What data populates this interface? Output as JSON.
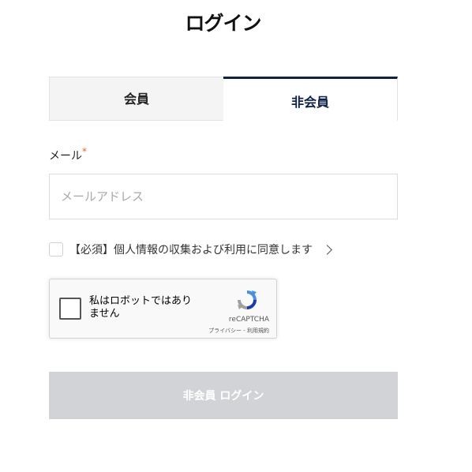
{
  "page": {
    "title": "ログイン"
  },
  "tabs": [
    {
      "label": "会員",
      "active": false
    },
    {
      "label": "非会員",
      "active": true
    }
  ],
  "form": {
    "email_label": "メール",
    "required_mark": "*",
    "email_placeholder": "メールアドレス",
    "email_value": "",
    "consent_text": "【必須】個人情報の収集および利用に同意します",
    "consent_checked": false,
    "submit_label": "非会員 ログイン"
  },
  "recaptcha": {
    "label": "私はロボットではありません",
    "brand": "reCAPTCHA",
    "links": "プライバシー - 利用規約",
    "checked": false
  },
  "colors": {
    "accent": "#0f2144",
    "required": "#e8623a",
    "submit_disabled": "#d2d3d6",
    "tab_inactive_bg": "#f4f4f5"
  },
  "icons": [
    "chevron-right-icon",
    "recaptcha-logo-icon"
  ]
}
